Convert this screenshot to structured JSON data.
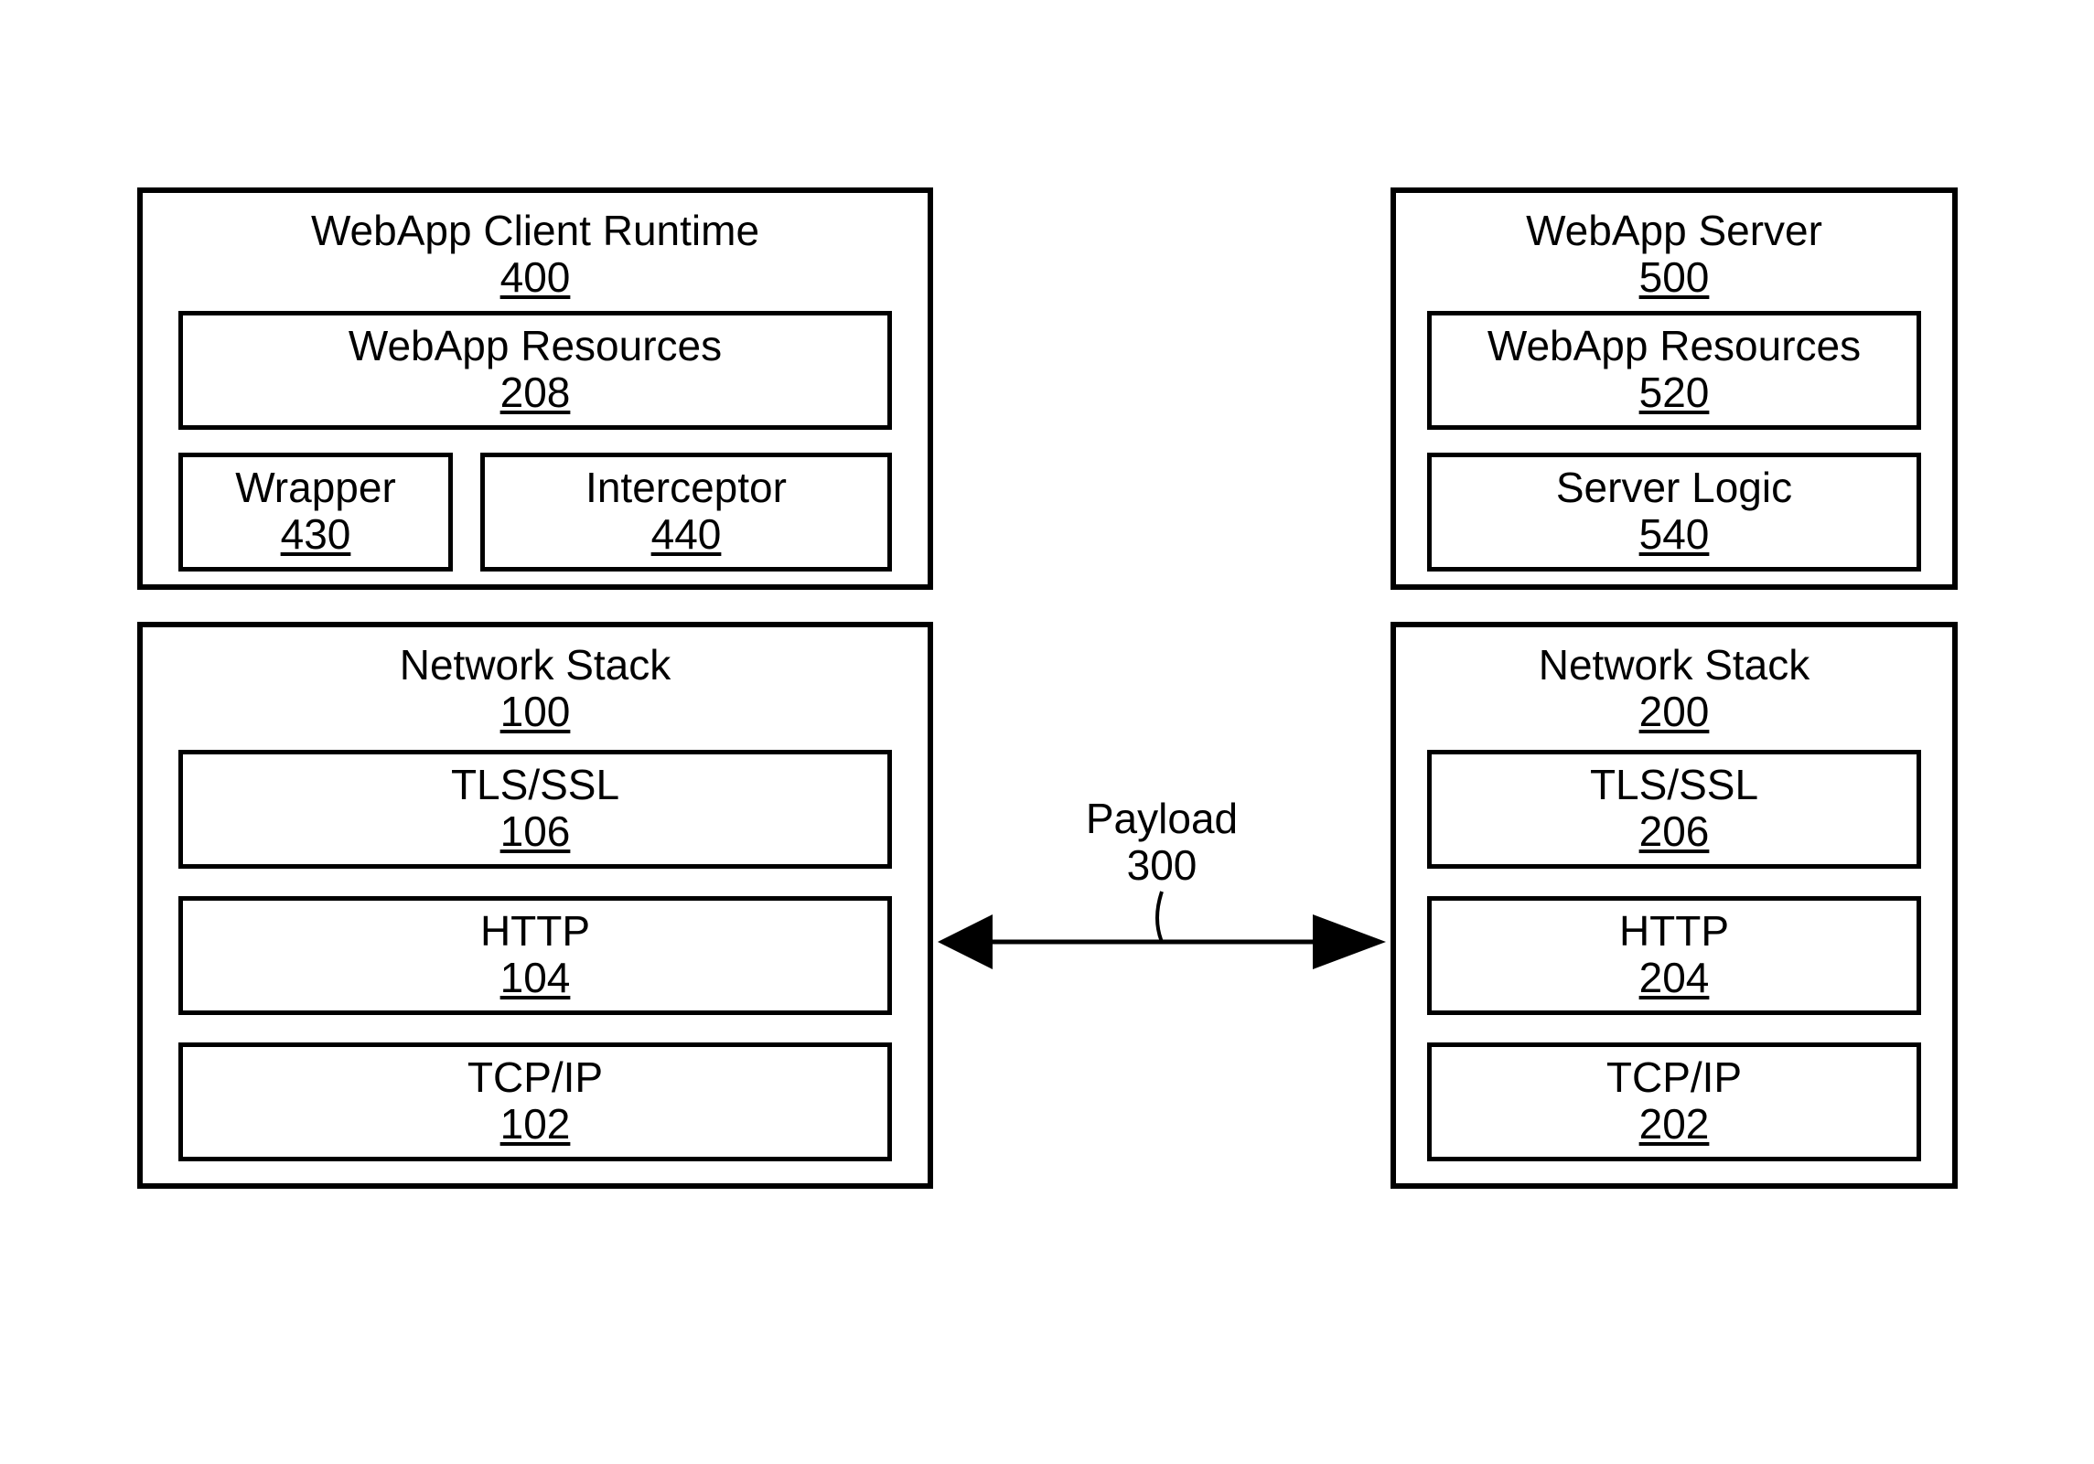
{
  "client": {
    "runtime": {
      "title": "WebApp Client Runtime",
      "num": "400"
    },
    "resources": {
      "title": "WebApp Resources",
      "num": "208"
    },
    "wrapper": {
      "title": "Wrapper",
      "num": "430"
    },
    "interceptor": {
      "title": "Interceptor",
      "num": "440"
    },
    "stack": {
      "title": "Network Stack",
      "num": "100"
    },
    "tls": {
      "title": "TLS/SSL",
      "num": "106"
    },
    "http": {
      "title": "HTTP",
      "num": "104"
    },
    "tcp": {
      "title": "TCP/IP",
      "num": "102"
    }
  },
  "server": {
    "top": {
      "title": "WebApp Server",
      "num": "500"
    },
    "resources": {
      "title": "WebApp Resources",
      "num": "520"
    },
    "logic": {
      "title": "Server Logic",
      "num": "540"
    },
    "stack": {
      "title": "Network Stack",
      "num": "200"
    },
    "tls": {
      "title": "TLS/SSL",
      "num": "206"
    },
    "http": {
      "title": "HTTP",
      "num": "204"
    },
    "tcp": {
      "title": "TCP/IP",
      "num": "202"
    }
  },
  "payload": {
    "title": "Payload",
    "num": "300"
  }
}
